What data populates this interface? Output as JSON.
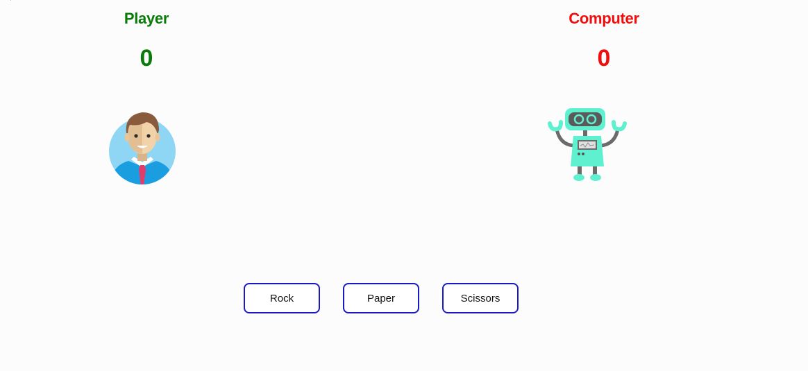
{
  "corner_mark": "ˀ",
  "player": {
    "title": "Player",
    "score": "0",
    "color": "#0a7a0a",
    "avatar_icon": "businessman-avatar-icon"
  },
  "computer": {
    "title": "Computer",
    "score": "0",
    "color": "#f20d0d",
    "avatar_icon": "robot-icon"
  },
  "choices": {
    "rock": "Rock",
    "paper": "Paper",
    "scissors": "Scissors",
    "border_color": "#1a1ac4"
  }
}
